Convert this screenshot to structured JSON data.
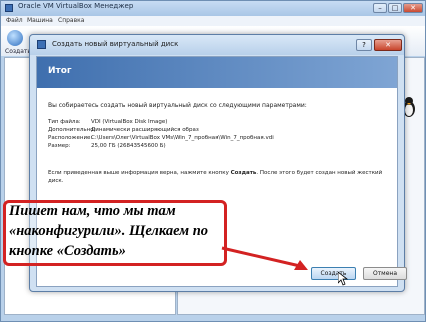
{
  "main_window": {
    "title": "Oracle VM VirtualBox Менеджер",
    "menu": [
      "Файл",
      "Машина",
      "Справка"
    ],
    "toolbar_create_label": "Создать",
    "controls": {
      "minimize": "–",
      "maximize": "□",
      "close": "✕"
    }
  },
  "dialog": {
    "title": "Создать новый виртуальный диск",
    "help_label": "?",
    "close_label": "✕",
    "page_title": "Итог",
    "intro": "Вы собираетесь создать новый виртуальный диск со следующими параметрами:",
    "params": [
      {
        "label": "Тип файла:",
        "value": "VDI (VirtualBox Disk Image)"
      },
      {
        "label": "Дополнительно:",
        "value": "Динамически расширяющийся образ"
      },
      {
        "label": "Расположение:",
        "value": "C:\\Users\\Олег\\VirtualBox VMs\\Win_7_пробная\\Win_7_пробная.vdi"
      },
      {
        "label": "Размер:",
        "value": "25,00 ГБ (26843545600 Б)"
      }
    ],
    "note_prefix": "Если приведенная выше информация верна, нажмите кнопку ",
    "note_bold": "Создать",
    "note_suffix": ". После этого будет создан новый жесткий диск.",
    "create_button": "Создать",
    "cancel_button": "Отмена"
  },
  "annotation": {
    "text": "Пишет нам, что мы там «наконфигурили». Щелкаем по кнопке «Создать»",
    "color": "#d32222"
  }
}
